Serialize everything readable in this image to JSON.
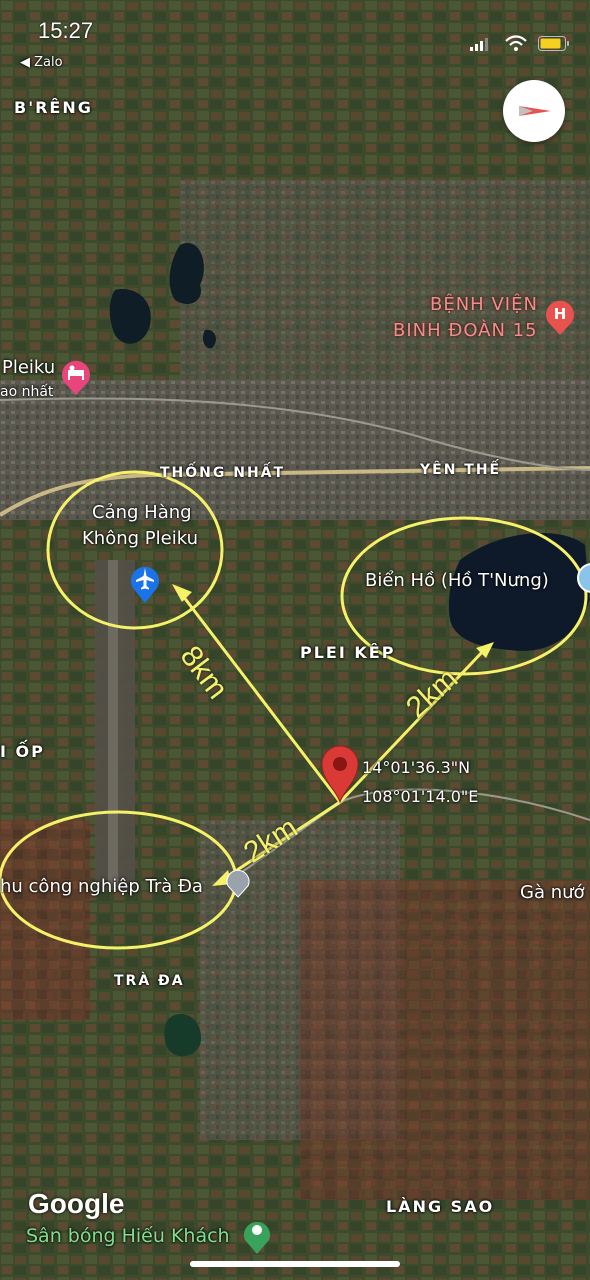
{
  "status_bar": {
    "time": "15:27",
    "back_app": "◀ Zalo"
  },
  "map": {
    "area_labels": [
      "B'RÊNG",
      "THỐNG NHẤT",
      "YÊN THẾ",
      "PLEI KÊP",
      "I ỐP",
      "TRÀ ĐA",
      "LÀNG SAO"
    ],
    "hospital": [
      "BỆNH VIỆN",
      "BINH ĐOÀN 15"
    ],
    "hotel_name": "Pleiku",
    "hotel_sub": "ao nhất",
    "airport": [
      "Cảng Hàng",
      "Không Pleiku"
    ],
    "lake": "Biển Hồ (Hồ T'Nưng)",
    "industrial_zone": "hu công nghiệp Trà Đa",
    "ga": "Gà nướ",
    "coordinates": [
      "14°01'36.3\"N",
      "108°01'14.0\"E"
    ],
    "distance_airport": "8km",
    "distance_lake": "2km",
    "distance_industrial": "2km",
    "google_logo": "Google",
    "stadium": "Sân bóng Hiếu Khách"
  },
  "colors": {
    "annotation": "#f5f26a",
    "pin": "#d93a36",
    "hospital": "#e8524e",
    "airport": "#1a73e8",
    "hotel": "#e8457d",
    "stadium": "#3aa35b"
  }
}
